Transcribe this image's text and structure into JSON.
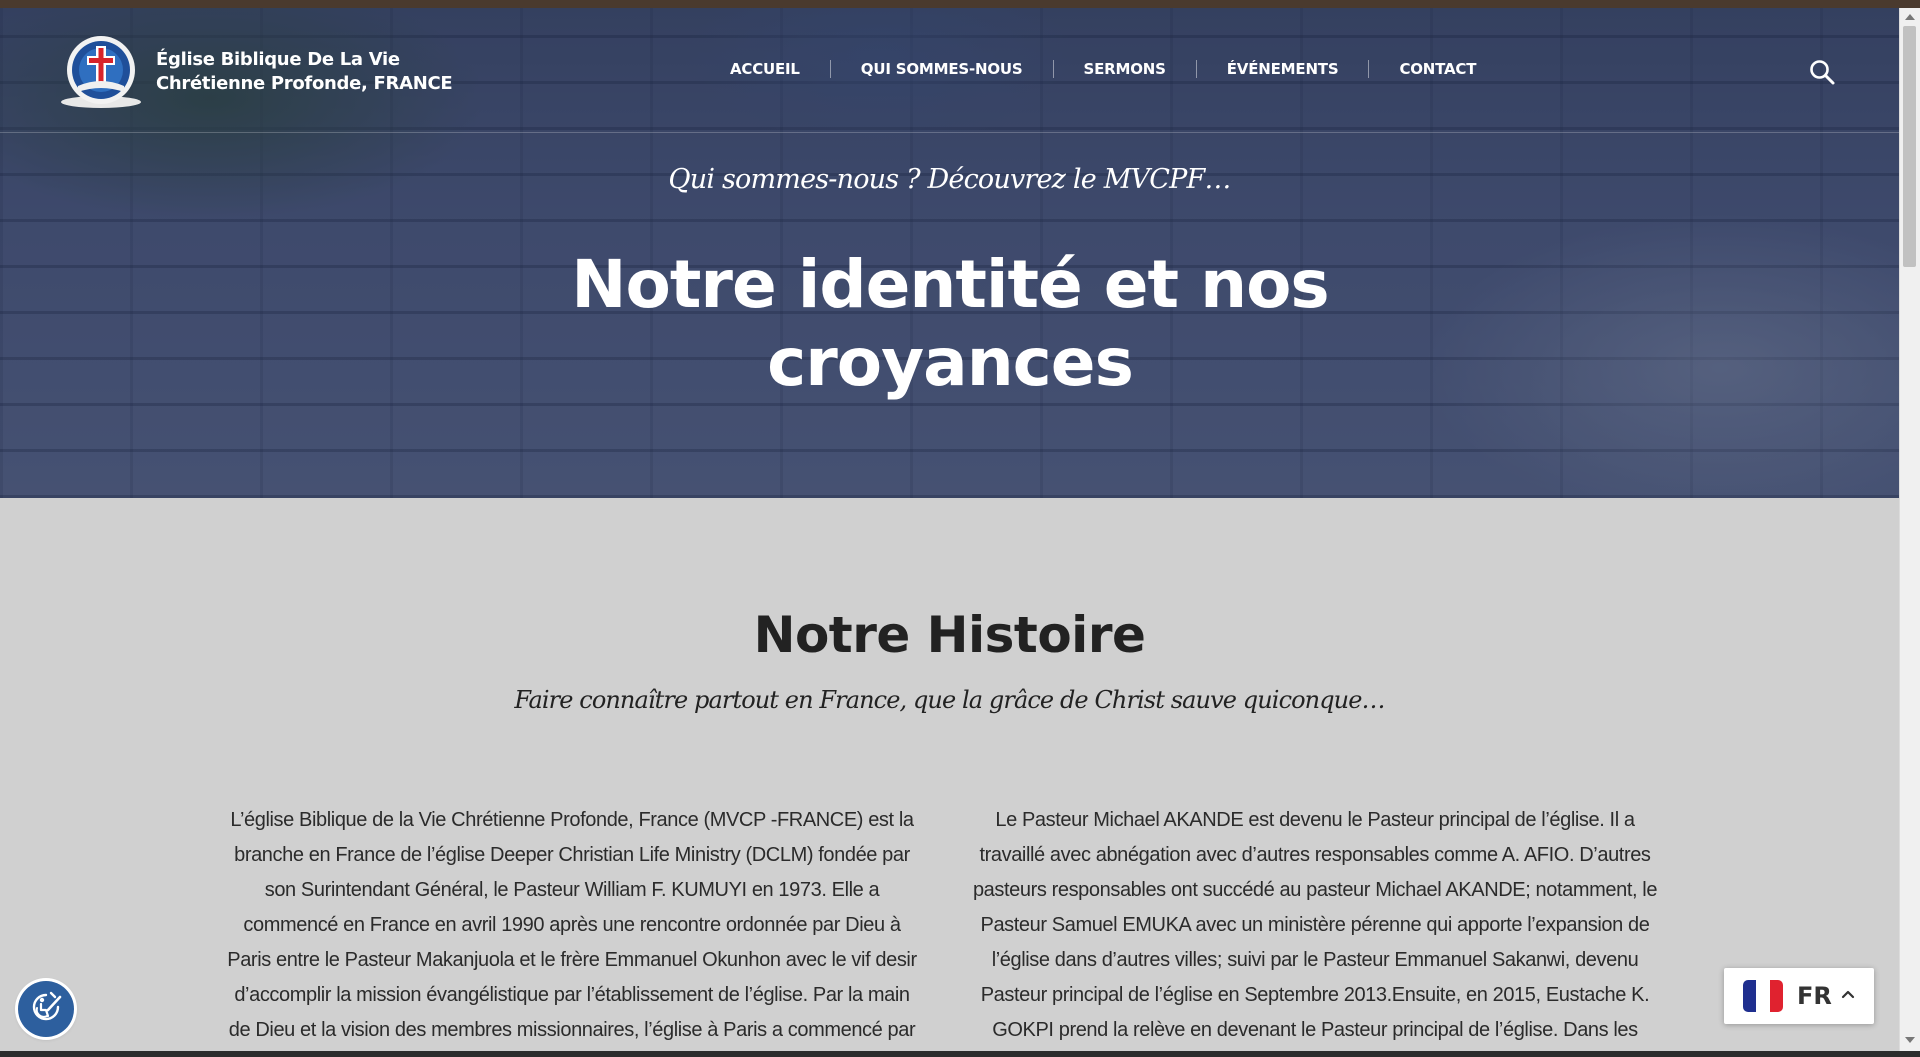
{
  "header": {
    "logo_line1": "Église Biblique De La Vie",
    "logo_line2": "Chrétienne Profonde, FRANCE",
    "nav": [
      {
        "label": "ACCUEIL"
      },
      {
        "label": "QUI SOMMES-NOUS"
      },
      {
        "label": "SERMONS"
      },
      {
        "label": "ÉVÉNEMENTS"
      },
      {
        "label": "CONTACT"
      }
    ]
  },
  "hero": {
    "eyebrow": "Qui sommes-nous ? Découvrez le MVCPF…",
    "title_line1": "Notre identité et nos",
    "title_line2": "croyances"
  },
  "histoire": {
    "title": "Notre Histoire",
    "subtitle": "Faire connaître partout en France, que la grâce de Christ sauve quiconque…",
    "col_left": [
      "L’église Biblique de la Vie Chrétienne Profonde, France (MVCP -FRANCE) est la",
      "branche en France de l’église Deeper Christian Life Ministry (DCLM) fondée par",
      "son Surintendant Général, le Pasteur William F. KUMUYI en 1973. Elle a",
      "commencé en France en avril 1990 après une rencontre ordonnée par Dieu à",
      "Paris entre le Pasteur Makanjuola et le frère Emmanuel Okunhon avec le vif desir",
      "d’accomplir la mission évangélistique par l’établissement de l’église. Par la main",
      "de Dieu et la vision des membres missionnaires, l’église à Paris a commencé par"
    ],
    "col_right": [
      "Le Pasteur Michael AKANDE est devenu le Pasteur principal de l’église. Il a",
      "travaillé avec abnégation avec d’autres responsables comme A. AFIO. D’autres",
      "pasteurs responsables ont succédé au pasteur Michael AKANDE; notamment, le",
      "Pasteur Samuel EMUKA avec un ministère pérenne qui apporte l’expansion de",
      "l’église dans d’autres villes; suivi par le Pasteur Emmanuel Sakanwi, devenu",
      "Pasteur principal de l’église en Septembre 2013.Ensuite, en 2015, Eustache K.",
      "GOKPI prend la relève en devenant le Pasteur principal de l’église. Dans les"
    ]
  },
  "language": {
    "code": "FR"
  },
  "icons": {
    "search": "search-icon",
    "accessibility": "accessibility-icon",
    "flag": "france-flag-icon",
    "chevron": "chevron-up-icon"
  },
  "colors": {
    "hero_overlay": "#202d55",
    "section_bg": "#d0d0d0",
    "heading": "#222222",
    "accessibility_button": "#2d5f9e",
    "flag_blue": "#1f2f8f",
    "flag_red": "#e0222f"
  }
}
